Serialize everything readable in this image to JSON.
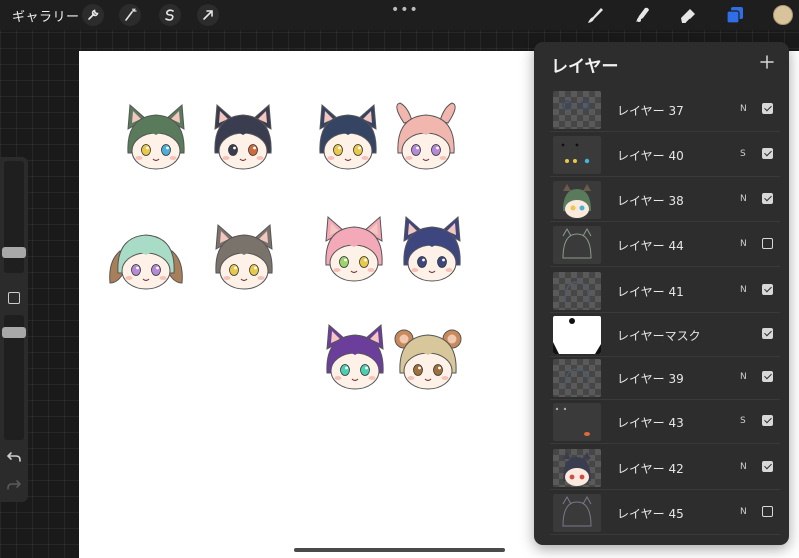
{
  "topbar": {
    "gallery_label": "ギャラリー",
    "left_tools": [
      "wrench-icon",
      "magic-wand-icon",
      "selection-icon",
      "transform-icon"
    ],
    "more_icon": "•••",
    "right_tools": [
      "brush-icon",
      "smudge-icon",
      "eraser-icon",
      "layers-icon"
    ],
    "active_color": "#d9c39a",
    "accent_color": "#2f6ee6"
  },
  "layers_panel": {
    "title": "レイヤー",
    "add_label": "+",
    "rows": [
      {
        "name": "レイヤー 37",
        "blend": "N",
        "visible": true
      },
      {
        "name": "レイヤー 40",
        "blend": "S",
        "visible": true
      },
      {
        "name": "レイヤー 38",
        "blend": "N",
        "visible": true
      },
      {
        "name": "レイヤー 44",
        "blend": "N",
        "visible": false
      },
      {
        "name": "レイヤー 41",
        "blend": "N",
        "visible": true
      },
      {
        "name": "レイヤーマスク",
        "blend": "",
        "visible": true
      },
      {
        "name": "レイヤー 39",
        "blend": "N",
        "visible": true
      },
      {
        "name": "レイヤー 43",
        "blend": "S",
        "visible": true
      },
      {
        "name": "レイヤー 42",
        "blend": "N",
        "visible": true
      },
      {
        "name": "レイヤー 45",
        "blend": "N",
        "visible": false
      }
    ]
  },
  "canvas": {
    "stickers": [
      {
        "ears": "cat",
        "hair": "#5a7a5c",
        "eyes": [
          "#e8c94a",
          "#4ab0d8"
        ]
      },
      {
        "ears": "cat",
        "hair": "#3a3d4f",
        "eyes": [
          "#3a3d4f",
          "#d06a3a"
        ]
      },
      {
        "ears": "cat",
        "hair": "#354463",
        "eyes": [
          "#e8c94a",
          "#e8c94a"
        ]
      },
      {
        "ears": "bunny",
        "hair": "#f1b6ae",
        "eyes": [
          "#b58ad8",
          "#b58ad8"
        ]
      },
      {
        "ears": "dog",
        "hair": "#a9dcc6",
        "eyes": [
          "#b58ad8",
          "#b58ad8"
        ]
      },
      {
        "ears": "cat",
        "hair": "#7a736c",
        "eyes": [
          "#e8c94a",
          "#e8c94a"
        ]
      },
      {
        "ears": "cat",
        "hair": "#f3a9b8",
        "eyes": [
          "#9ad46a",
          "#e8c94a"
        ]
      },
      {
        "ears": "cat",
        "hair": "#3e4680",
        "eyes": [
          "#3e4680",
          "#3e4680"
        ]
      },
      {
        "ears": "cat",
        "hair": "#6a3e9a",
        "eyes": [
          "#4ad0b0",
          "#4ad0b0"
        ]
      },
      {
        "ears": "hamster",
        "hair": "#d8c79a",
        "eyes": [
          "#a0703a",
          "#a0703a"
        ]
      }
    ]
  }
}
